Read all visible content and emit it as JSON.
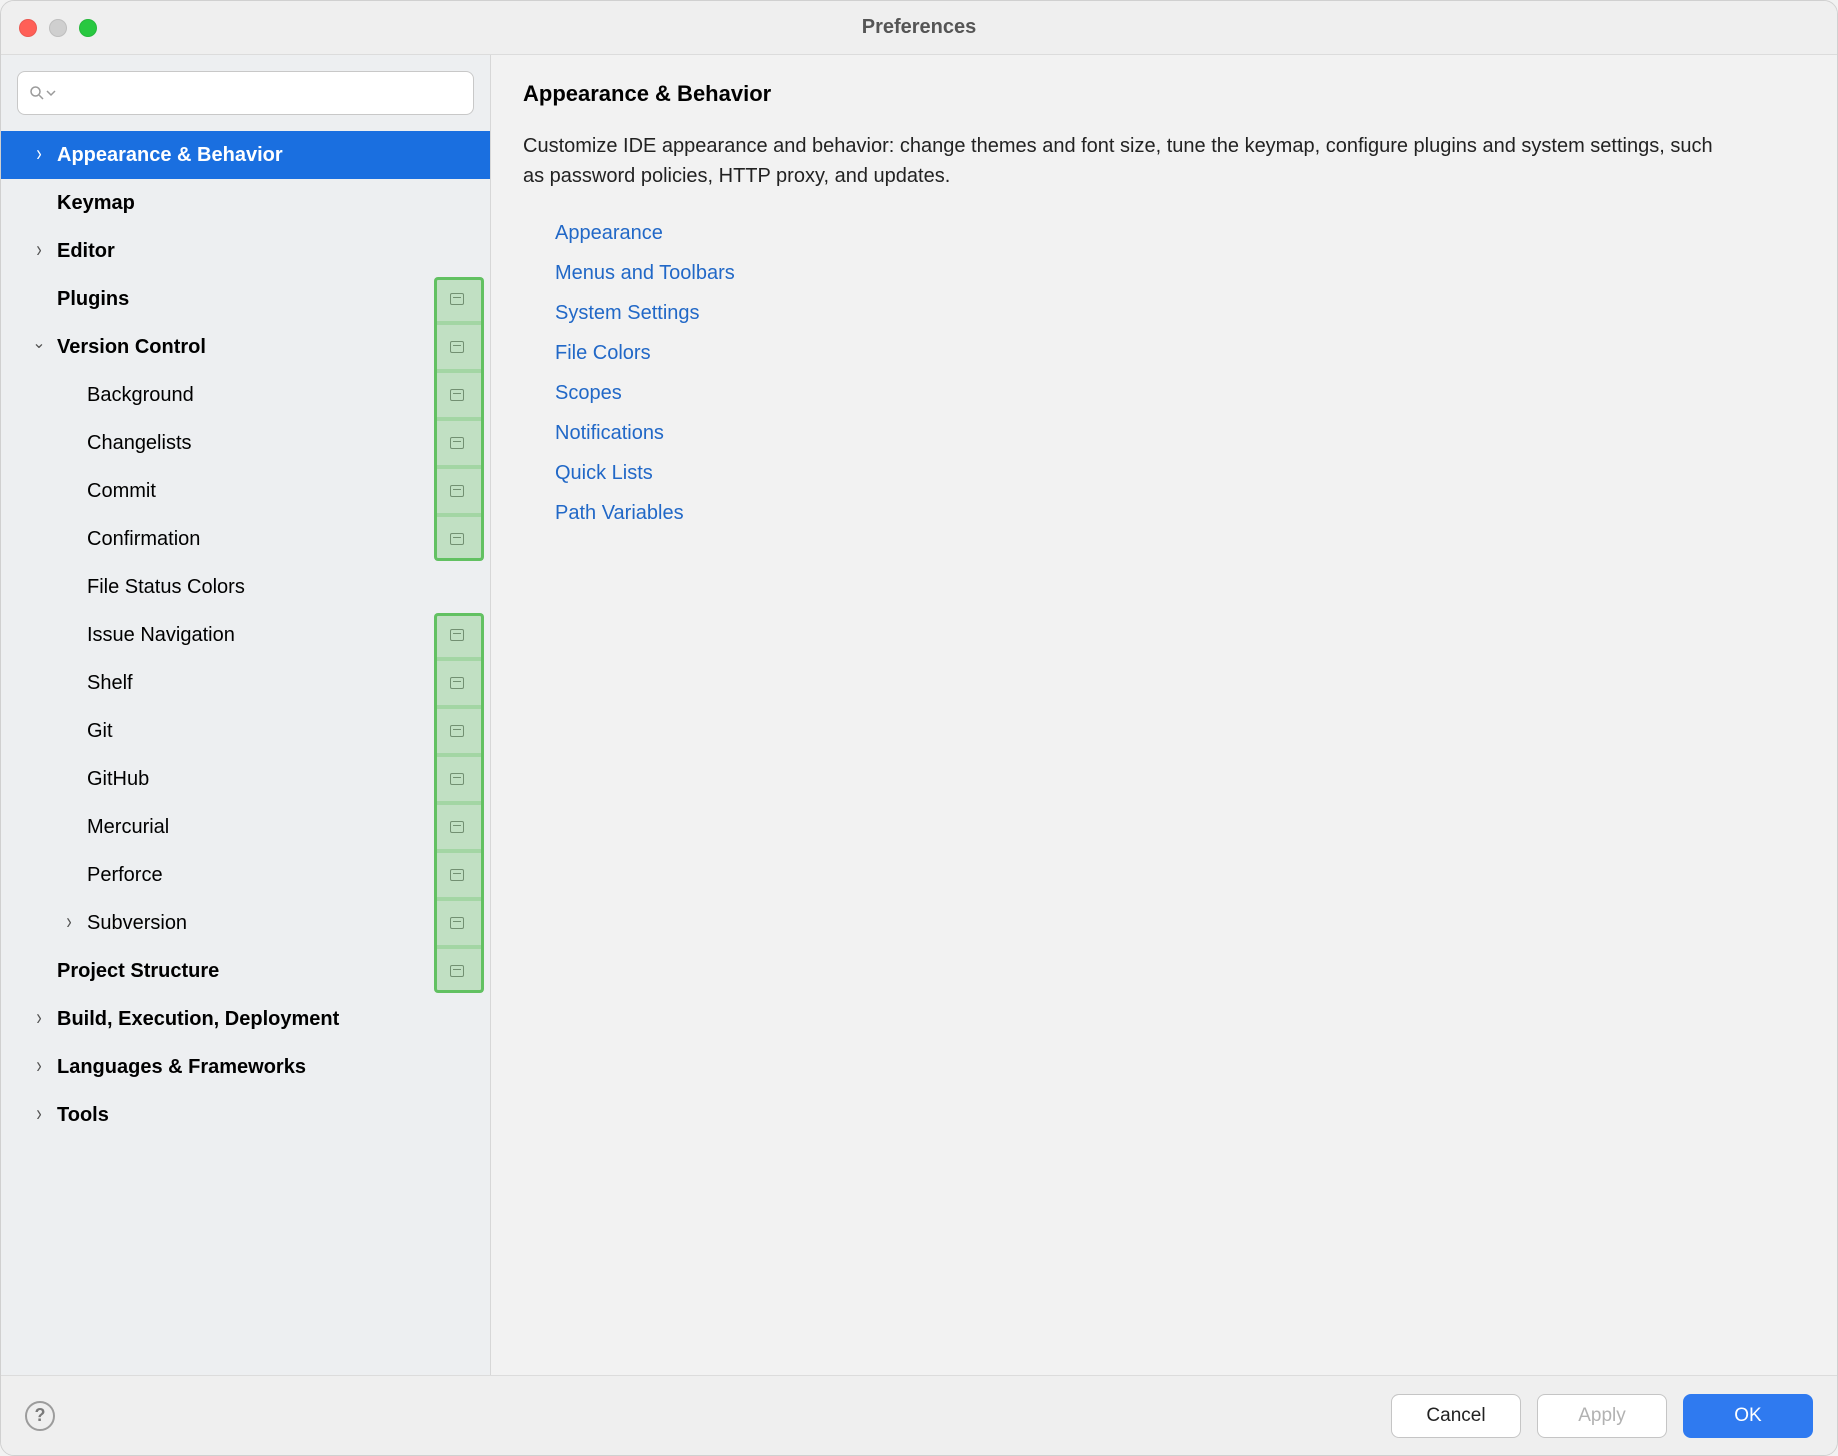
{
  "window": {
    "title": "Preferences"
  },
  "search": {
    "placeholder": ""
  },
  "tree": [
    {
      "id": "appearance",
      "label": "Appearance & Behavior",
      "depth": 0,
      "bold": true,
      "arrow": "right",
      "selected": true,
      "badge": false,
      "hl": false
    },
    {
      "id": "keymap",
      "label": "Keymap",
      "depth": 0,
      "bold": true,
      "arrow": null,
      "selected": false,
      "badge": false,
      "hl": false
    },
    {
      "id": "editor",
      "label": "Editor",
      "depth": 0,
      "bold": true,
      "arrow": "right",
      "selected": false,
      "badge": false,
      "hl": false
    },
    {
      "id": "plugins",
      "label": "Plugins",
      "depth": 0,
      "bold": true,
      "arrow": null,
      "selected": false,
      "badge": true,
      "hl": "start"
    },
    {
      "id": "vcs",
      "label": "Version Control",
      "depth": 0,
      "bold": true,
      "arrow": "down",
      "selected": false,
      "badge": true,
      "hl": "mid"
    },
    {
      "id": "vcs-bg",
      "label": "Background",
      "depth": 1,
      "bold": false,
      "arrow": null,
      "selected": false,
      "badge": true,
      "hl": "mid"
    },
    {
      "id": "vcs-changelists",
      "label": "Changelists",
      "depth": 1,
      "bold": false,
      "arrow": null,
      "selected": false,
      "badge": true,
      "hl": "mid"
    },
    {
      "id": "vcs-commit",
      "label": "Commit",
      "depth": 1,
      "bold": false,
      "arrow": null,
      "selected": false,
      "badge": true,
      "hl": "mid"
    },
    {
      "id": "vcs-confirm",
      "label": "Confirmation",
      "depth": 1,
      "bold": false,
      "arrow": null,
      "selected": false,
      "badge": true,
      "hl": "end"
    },
    {
      "id": "vcs-filestatus",
      "label": "File Status Colors",
      "depth": 1,
      "bold": false,
      "arrow": null,
      "selected": false,
      "badge": false,
      "hl": false
    },
    {
      "id": "vcs-issuenav",
      "label": "Issue Navigation",
      "depth": 1,
      "bold": false,
      "arrow": null,
      "selected": false,
      "badge": true,
      "hl": "start"
    },
    {
      "id": "vcs-shelf",
      "label": "Shelf",
      "depth": 1,
      "bold": false,
      "arrow": null,
      "selected": false,
      "badge": true,
      "hl": "mid"
    },
    {
      "id": "vcs-git",
      "label": "Git",
      "depth": 1,
      "bold": false,
      "arrow": null,
      "selected": false,
      "badge": true,
      "hl": "mid"
    },
    {
      "id": "vcs-github",
      "label": "GitHub",
      "depth": 1,
      "bold": false,
      "arrow": null,
      "selected": false,
      "badge": true,
      "hl": "mid"
    },
    {
      "id": "vcs-hg",
      "label": "Mercurial",
      "depth": 1,
      "bold": false,
      "arrow": null,
      "selected": false,
      "badge": true,
      "hl": "mid"
    },
    {
      "id": "vcs-p4",
      "label": "Perforce",
      "depth": 1,
      "bold": false,
      "arrow": null,
      "selected": false,
      "badge": true,
      "hl": "mid"
    },
    {
      "id": "vcs-svn",
      "label": "Subversion",
      "depth": 1,
      "bold": false,
      "arrow": "right",
      "selected": false,
      "badge": true,
      "hl": "mid"
    },
    {
      "id": "projstruct",
      "label": "Project Structure",
      "depth": 0,
      "bold": true,
      "arrow": null,
      "selected": false,
      "badge": true,
      "hl": "end"
    },
    {
      "id": "build",
      "label": "Build, Execution, Deployment",
      "depth": 0,
      "bold": true,
      "arrow": "right",
      "selected": false,
      "badge": false,
      "hl": false
    },
    {
      "id": "lang",
      "label": "Languages & Frameworks",
      "depth": 0,
      "bold": true,
      "arrow": "right",
      "selected": false,
      "badge": false,
      "hl": false
    },
    {
      "id": "tools",
      "label": "Tools",
      "depth": 0,
      "bold": true,
      "arrow": "right",
      "selected": false,
      "badge": false,
      "hl": false
    }
  ],
  "main": {
    "heading": "Appearance & Behavior",
    "desc": "Customize IDE appearance and behavior: change themes and font size, tune the keymap, configure plugins and system settings, such as password policies, HTTP proxy, and updates.",
    "links": [
      "Appearance",
      "Menus and Toolbars",
      "System Settings",
      "File Colors",
      "Scopes",
      "Notifications",
      "Quick Lists",
      "Path Variables"
    ]
  },
  "footer": {
    "cancel": "Cancel",
    "apply": "Apply",
    "ok": "OK"
  }
}
